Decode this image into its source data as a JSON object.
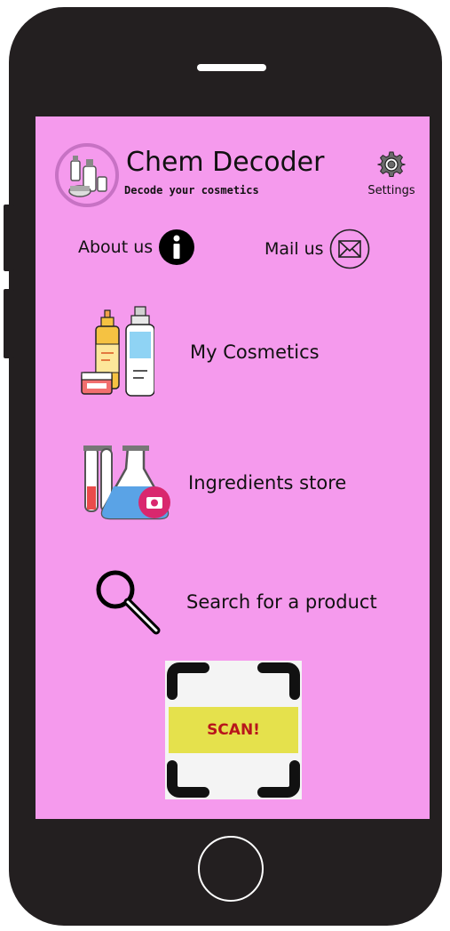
{
  "app": {
    "title": "Chem Decoder",
    "subtitle": "Decode your cosmetics"
  },
  "header": {
    "settings_label": "Settings"
  },
  "links": {
    "about_label": "About us",
    "mail_label": "Mail us"
  },
  "menu": [
    {
      "label": "My Cosmetics",
      "icon": "cosmetics-bottles-icon"
    },
    {
      "label": "Ingredients store",
      "icon": "flask-camera-icon"
    },
    {
      "label": "Search for a product",
      "icon": "magnifier-icon"
    }
  ],
  "scan": {
    "label": "SCAN!"
  },
  "colors": {
    "screen_bg": "#f59aed",
    "phone_body": "#231f20",
    "scan_band": "#e5e14c",
    "scan_text": "#b8161b",
    "logo_ring": "#c772c4"
  }
}
